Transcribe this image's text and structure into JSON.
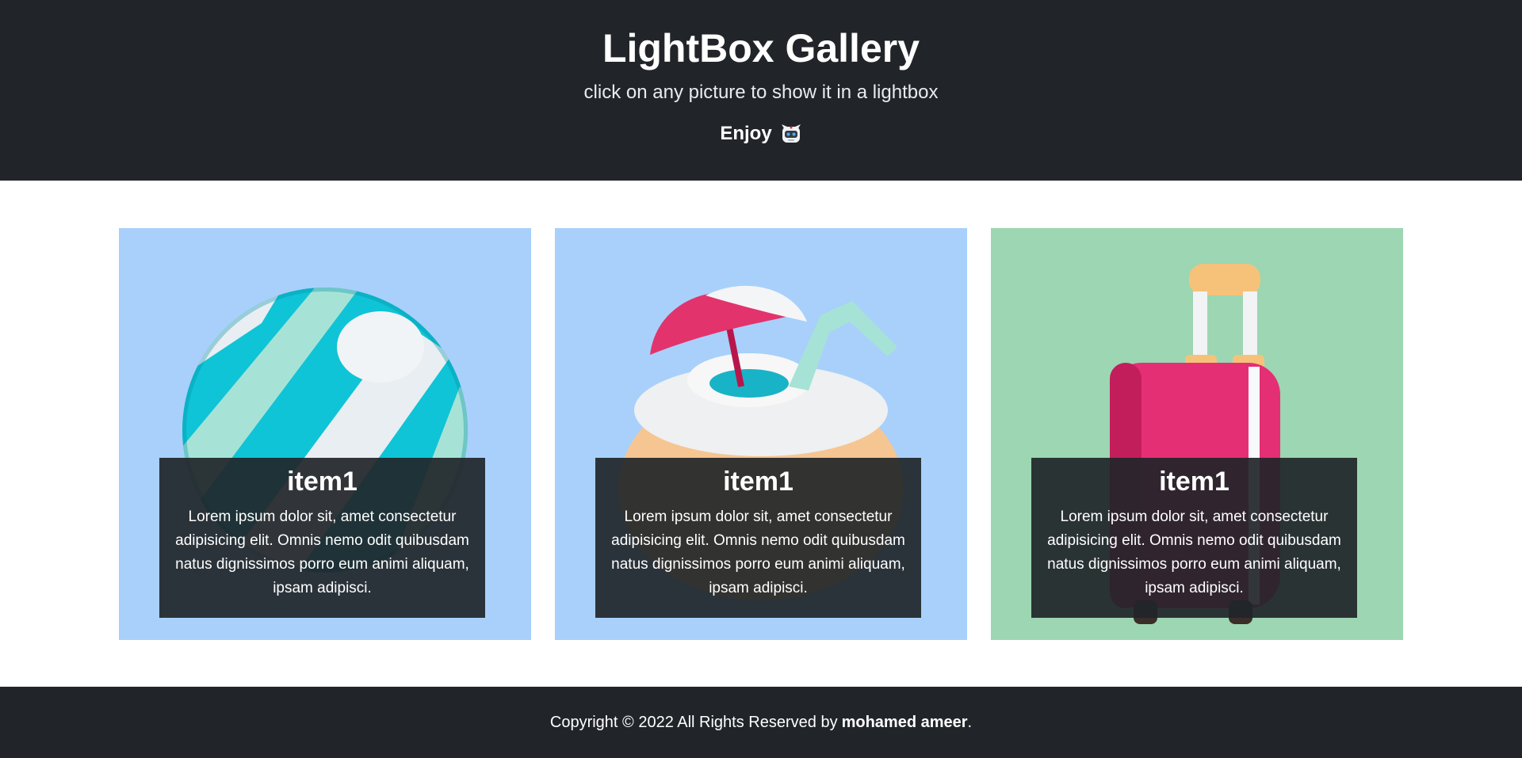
{
  "header": {
    "title": "LightBox Gallery",
    "subtitle": "click on any picture to show it in a lightbox",
    "enjoy": "Enjoy",
    "emoji_icon": "robot-face-icon"
  },
  "gallery": {
    "items": [
      {
        "title": "item1",
        "text": "Lorem ipsum dolor sit, amet consectetur adipisicing elit. Omnis nemo odit quibusdam natus dignissimos porro eum animi aliquam, ipsam adipisci.",
        "image": "beach-ball-icon",
        "background": "#a8d0fb"
      },
      {
        "title": "item1",
        "text": "Lorem ipsum dolor sit, amet consectetur adipisicing elit. Omnis nemo odit quibusdam natus dignissimos porro eum animi aliquam, ipsam adipisci.",
        "image": "coconut-drink-icon",
        "background": "#a8d0fb"
      },
      {
        "title": "item1",
        "text": "Lorem ipsum dolor sit, amet consectetur adipisicing elit. Omnis nemo odit quibusdam natus dignissimos porro eum animi aliquam, ipsam adipisci.",
        "image": "suitcase-icon",
        "background": "#9dd6b2"
      }
    ]
  },
  "footer": {
    "text": "Copyright © 2022 All Rights Reserved by",
    "author": "mohamed ameer",
    "end": "."
  },
  "colors": {
    "dark": "#212529",
    "caption_bg": "#212529",
    "white": "#ffffff"
  }
}
